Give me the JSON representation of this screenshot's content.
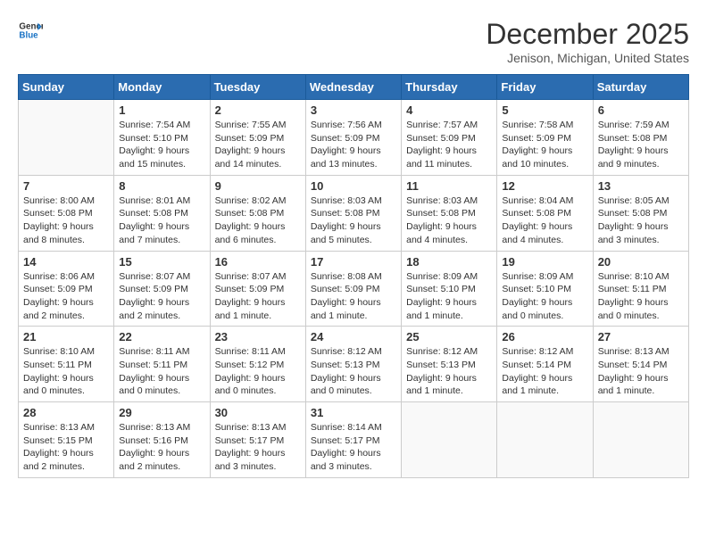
{
  "logo": {
    "line1": "General",
    "line2": "Blue"
  },
  "title": "December 2025",
  "subtitle": "Jenison, Michigan, United States",
  "days_of_week": [
    "Sunday",
    "Monday",
    "Tuesday",
    "Wednesday",
    "Thursday",
    "Friday",
    "Saturday"
  ],
  "weeks": [
    [
      {
        "day": "",
        "info": ""
      },
      {
        "day": "1",
        "info": "Sunrise: 7:54 AM\nSunset: 5:10 PM\nDaylight: 9 hours\nand 15 minutes."
      },
      {
        "day": "2",
        "info": "Sunrise: 7:55 AM\nSunset: 5:09 PM\nDaylight: 9 hours\nand 14 minutes."
      },
      {
        "day": "3",
        "info": "Sunrise: 7:56 AM\nSunset: 5:09 PM\nDaylight: 9 hours\nand 13 minutes."
      },
      {
        "day": "4",
        "info": "Sunrise: 7:57 AM\nSunset: 5:09 PM\nDaylight: 9 hours\nand 11 minutes."
      },
      {
        "day": "5",
        "info": "Sunrise: 7:58 AM\nSunset: 5:09 PM\nDaylight: 9 hours\nand 10 minutes."
      },
      {
        "day": "6",
        "info": "Sunrise: 7:59 AM\nSunset: 5:08 PM\nDaylight: 9 hours\nand 9 minutes."
      }
    ],
    [
      {
        "day": "7",
        "info": "Sunrise: 8:00 AM\nSunset: 5:08 PM\nDaylight: 9 hours\nand 8 minutes."
      },
      {
        "day": "8",
        "info": "Sunrise: 8:01 AM\nSunset: 5:08 PM\nDaylight: 9 hours\nand 7 minutes."
      },
      {
        "day": "9",
        "info": "Sunrise: 8:02 AM\nSunset: 5:08 PM\nDaylight: 9 hours\nand 6 minutes."
      },
      {
        "day": "10",
        "info": "Sunrise: 8:03 AM\nSunset: 5:08 PM\nDaylight: 9 hours\nand 5 minutes."
      },
      {
        "day": "11",
        "info": "Sunrise: 8:03 AM\nSunset: 5:08 PM\nDaylight: 9 hours\nand 4 minutes."
      },
      {
        "day": "12",
        "info": "Sunrise: 8:04 AM\nSunset: 5:08 PM\nDaylight: 9 hours\nand 4 minutes."
      },
      {
        "day": "13",
        "info": "Sunrise: 8:05 AM\nSunset: 5:08 PM\nDaylight: 9 hours\nand 3 minutes."
      }
    ],
    [
      {
        "day": "14",
        "info": "Sunrise: 8:06 AM\nSunset: 5:09 PM\nDaylight: 9 hours\nand 2 minutes."
      },
      {
        "day": "15",
        "info": "Sunrise: 8:07 AM\nSunset: 5:09 PM\nDaylight: 9 hours\nand 2 minutes."
      },
      {
        "day": "16",
        "info": "Sunrise: 8:07 AM\nSunset: 5:09 PM\nDaylight: 9 hours\nand 1 minute."
      },
      {
        "day": "17",
        "info": "Sunrise: 8:08 AM\nSunset: 5:09 PM\nDaylight: 9 hours\nand 1 minute."
      },
      {
        "day": "18",
        "info": "Sunrise: 8:09 AM\nSunset: 5:10 PM\nDaylight: 9 hours\nand 1 minute."
      },
      {
        "day": "19",
        "info": "Sunrise: 8:09 AM\nSunset: 5:10 PM\nDaylight: 9 hours\nand 0 minutes."
      },
      {
        "day": "20",
        "info": "Sunrise: 8:10 AM\nSunset: 5:11 PM\nDaylight: 9 hours\nand 0 minutes."
      }
    ],
    [
      {
        "day": "21",
        "info": "Sunrise: 8:10 AM\nSunset: 5:11 PM\nDaylight: 9 hours\nand 0 minutes."
      },
      {
        "day": "22",
        "info": "Sunrise: 8:11 AM\nSunset: 5:11 PM\nDaylight: 9 hours\nand 0 minutes."
      },
      {
        "day": "23",
        "info": "Sunrise: 8:11 AM\nSunset: 5:12 PM\nDaylight: 9 hours\nand 0 minutes."
      },
      {
        "day": "24",
        "info": "Sunrise: 8:12 AM\nSunset: 5:13 PM\nDaylight: 9 hours\nand 0 minutes."
      },
      {
        "day": "25",
        "info": "Sunrise: 8:12 AM\nSunset: 5:13 PM\nDaylight: 9 hours\nand 1 minute."
      },
      {
        "day": "26",
        "info": "Sunrise: 8:12 AM\nSunset: 5:14 PM\nDaylight: 9 hours\nand 1 minute."
      },
      {
        "day": "27",
        "info": "Sunrise: 8:13 AM\nSunset: 5:14 PM\nDaylight: 9 hours\nand 1 minute."
      }
    ],
    [
      {
        "day": "28",
        "info": "Sunrise: 8:13 AM\nSunset: 5:15 PM\nDaylight: 9 hours\nand 2 minutes."
      },
      {
        "day": "29",
        "info": "Sunrise: 8:13 AM\nSunset: 5:16 PM\nDaylight: 9 hours\nand 2 minutes."
      },
      {
        "day": "30",
        "info": "Sunrise: 8:13 AM\nSunset: 5:17 PM\nDaylight: 9 hours\nand 3 minutes."
      },
      {
        "day": "31",
        "info": "Sunrise: 8:14 AM\nSunset: 5:17 PM\nDaylight: 9 hours\nand 3 minutes."
      },
      {
        "day": "",
        "info": ""
      },
      {
        "day": "",
        "info": ""
      },
      {
        "day": "",
        "info": ""
      }
    ]
  ]
}
